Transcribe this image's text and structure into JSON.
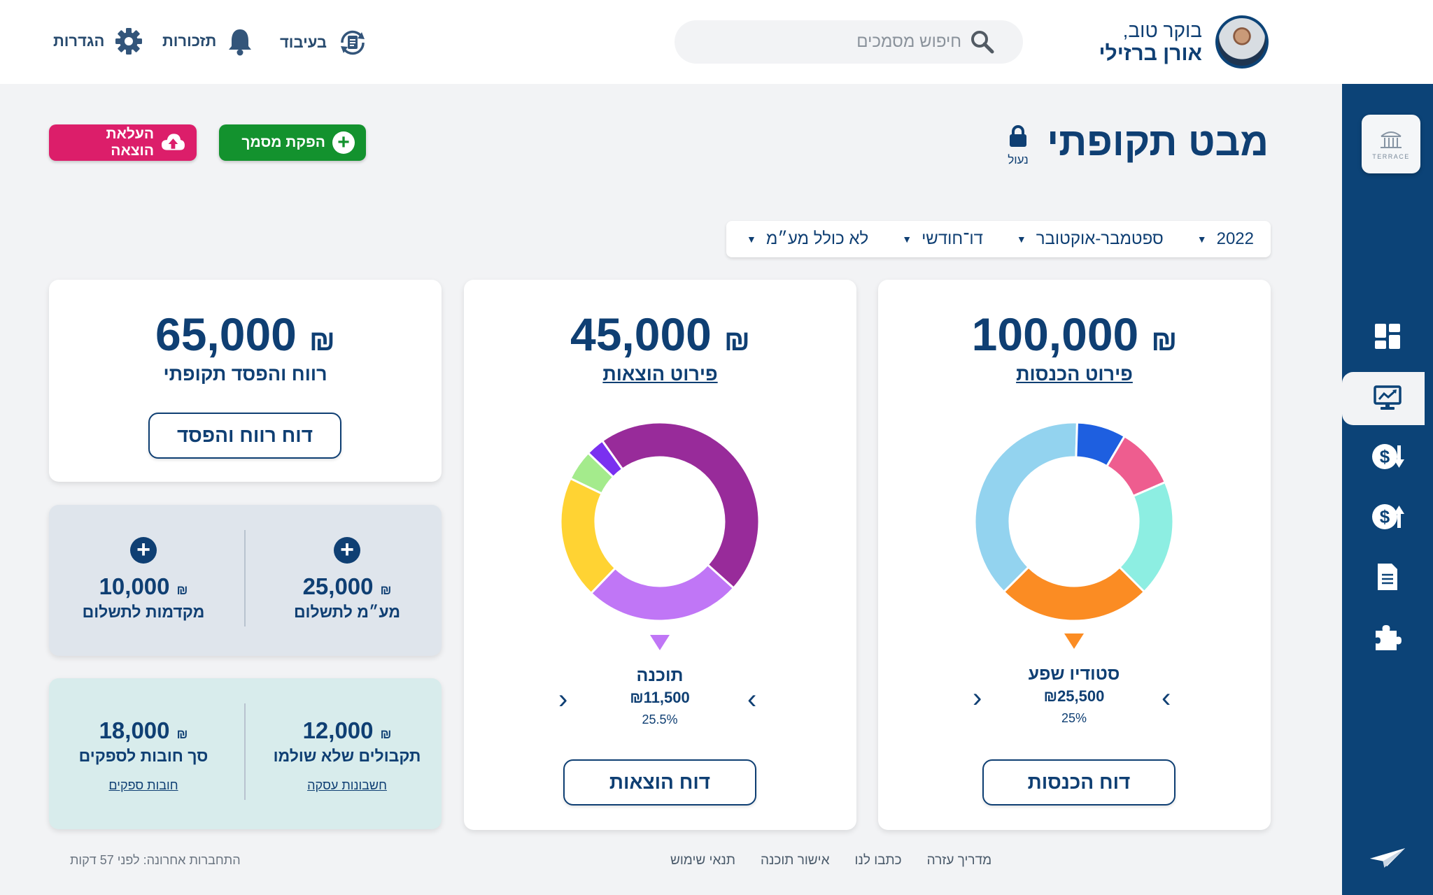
{
  "header": {
    "greeting": "בוקר טוב,",
    "user_name": "אורן ברזילי",
    "search_placeholder": "חיפוש מסמכים",
    "actions": [
      {
        "label": "בעיבוד",
        "icon": "processing-documents-icon"
      },
      {
        "label": "תזכורות",
        "icon": "bell-icon"
      },
      {
        "label": "הגדרות",
        "icon": "gear-icon"
      }
    ]
  },
  "page": {
    "title": "מבט תקופתי",
    "lock_label": "נעול",
    "buttons": {
      "create_document": "הפקת מסמך",
      "upload_expense": "העלאת הוצאה"
    }
  },
  "filters": [
    {
      "value": "2022"
    },
    {
      "value": "ספטמבר-אוקטובר"
    },
    {
      "value": "דו־חודשי"
    },
    {
      "value": "לא כולל מע״מ"
    }
  ],
  "income": {
    "amount": "100,000",
    "currency": "₪",
    "title": "פירוט הכנסות",
    "selected": {
      "name": "סטודיו שפע",
      "value": "₪25,500",
      "percent": "25%"
    },
    "report_button": "דוח הכנסות"
  },
  "expenses": {
    "amount": "45,000",
    "currency": "₪",
    "title": "פירוט הוצאות",
    "selected": {
      "name": "תוכנה",
      "value": "₪11,500",
      "percent": "25.5%"
    },
    "report_button": "דוח הוצאות"
  },
  "profit": {
    "amount": "65,000",
    "currency": "₪",
    "title": "רווח והפסד תקופתי",
    "report_button": "דוח רווח והפסד"
  },
  "payments": {
    "vat": {
      "amount": "25,000",
      "currency": "₪",
      "label": "מע״מ לתשלום"
    },
    "advances": {
      "amount": "10,000",
      "currency": "₪",
      "label": "מקדמות לתשלום"
    }
  },
  "balances": {
    "receivables": {
      "amount": "12,000",
      "currency": "₪",
      "label": "תקבולים שלא שולמו",
      "link": "חשבונות עסקה"
    },
    "payables": {
      "amount": "18,000",
      "currency": "₪",
      "label": "סך חובות לספקים",
      "link": "חובות ספקים"
    }
  },
  "footer": {
    "links": [
      "מדריך עזרה",
      "כתבו לנו",
      "אישור תוכנה",
      "תנאי שימוש"
    ],
    "last_login": "התחברות אחרונה: לפני 57 דקות"
  },
  "logo": {
    "text": "TERRACE"
  },
  "sidebar_icons": [
    "dashboard-icon",
    "overview-monitor-icon",
    "income-dollar-icon",
    "expense-dollar-icon",
    "document-icon",
    "puzzle-icon",
    "send-icon"
  ],
  "chart_data": [
    {
      "type": "pie",
      "title": "פירוט הכנסות",
      "slices": [
        {
          "label": "סטודיו שפע",
          "value": 25,
          "color": "#fb8c23"
        },
        {
          "label": "",
          "value": 38,
          "color": "#93d3ef"
        },
        {
          "label": "",
          "value": 8,
          "color": "#1e5fe0"
        },
        {
          "label": "",
          "value": 10,
          "color": "#ee5d8f"
        },
        {
          "label": "",
          "value": 19,
          "color": "#8deee2"
        }
      ]
    },
    {
      "type": "pie",
      "title": "פירוט הוצאות",
      "slices": [
        {
          "label": "תוכנה",
          "value": 25.5,
          "color": "#c076f6"
        },
        {
          "label": "",
          "value": 20,
          "color": "#ffd333"
        },
        {
          "label": "",
          "value": 5,
          "color": "#a4eb8c"
        },
        {
          "label": "",
          "value": 3,
          "color": "#7a30f0"
        },
        {
          "label": "",
          "value": 46.5,
          "color": "#982b9a"
        }
      ]
    }
  ],
  "colors": {
    "primary": "#0f3f73",
    "sidebar": "#0c4377",
    "green_button": "#13922e",
    "pink_button": "#dc1e6a",
    "payments_card": "#dfe5ec",
    "balances_card": "#d8ecec"
  }
}
